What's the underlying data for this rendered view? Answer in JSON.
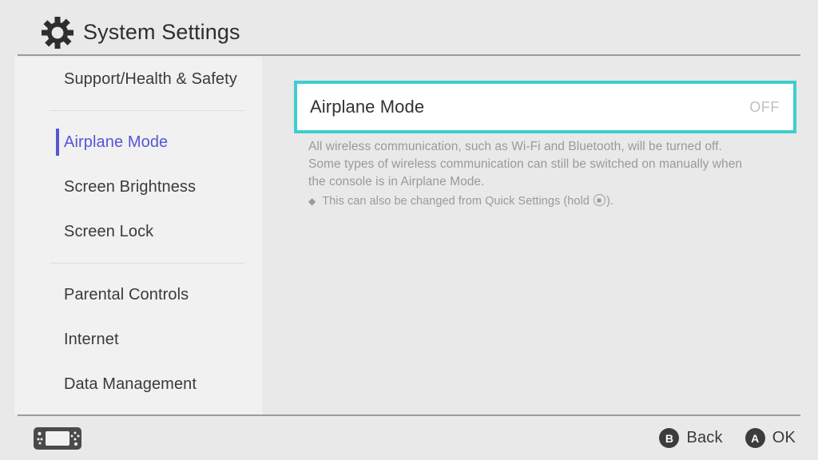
{
  "header": {
    "title": "System Settings",
    "icon": "gear-icon"
  },
  "sidebar": {
    "groups": [
      {
        "items": [
          {
            "label": "Support/Health & Safety",
            "selected": false
          }
        ]
      },
      {
        "items": [
          {
            "label": "Airplane Mode",
            "selected": true
          },
          {
            "label": "Screen Brightness",
            "selected": false
          },
          {
            "label": "Screen Lock",
            "selected": false
          }
        ]
      },
      {
        "items": [
          {
            "label": "Parental Controls",
            "selected": false
          },
          {
            "label": "Internet",
            "selected": false
          },
          {
            "label": "Data Management",
            "selected": false
          }
        ]
      }
    ]
  },
  "main": {
    "setting": {
      "name": "Airplane Mode",
      "value": "OFF"
    },
    "description": "All wireless communication, such as Wi-Fi and Bluetooth, will be turned off. Some types of wireless communication can still be switched on manually when the console is in Airplane Mode.",
    "note": {
      "bullet": "◆",
      "text_before": "This can also be changed from Quick Settings (hold",
      "text_after": ")."
    }
  },
  "footer": {
    "console_icon": "nintendo-switch-console-icon",
    "actions": [
      {
        "button": "B",
        "label": "Back"
      },
      {
        "button": "A",
        "label": "OK"
      }
    ]
  },
  "colors": {
    "accent_selection": "#40cdd0",
    "accent_nav": "#5656d6",
    "page_bg": "#e9e9e9",
    "sidebar_bg": "#f1f1f1",
    "value_text": "#c0c0c0"
  }
}
